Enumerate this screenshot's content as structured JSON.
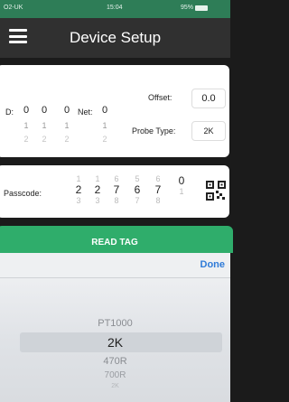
{
  "status_bar": {
    "carrier": "O2-UK",
    "time": "15:04",
    "battery": "95%"
  },
  "app_bar": {
    "title": "Device Setup",
    "menu_icon": "hamburger-icon"
  },
  "device": {
    "id_label": "D:",
    "id_wheels": [
      {
        "selected": "0",
        "below": "1",
        "far": "2"
      },
      {
        "selected": "0",
        "below": "1",
        "far": "2"
      },
      {
        "selected": "0",
        "below": "1",
        "far": "2"
      }
    ],
    "net_label": "Net:",
    "net_wheel": {
      "selected": "0",
      "below": "1",
      "far": "2"
    },
    "offset_label": "Offset:",
    "offset_value": "0.0",
    "probe_type_label": "Probe Type:",
    "probe_type_value": "2K"
  },
  "passcode": {
    "label": "Passcode:",
    "wheels": [
      {
        "above": "1",
        "selected": "2",
        "below": "3"
      },
      {
        "above": "1",
        "selected": "2",
        "below": "3"
      },
      {
        "above": "6",
        "selected": "7",
        "below": "8"
      },
      {
        "above": "5",
        "selected": "6",
        "below": "7"
      },
      {
        "above": "6",
        "selected": "7",
        "below": "8"
      },
      {
        "above": "",
        "selected": "0",
        "below": "1"
      }
    ],
    "qr_icon": "qr-code-icon"
  },
  "read_button": {
    "label": "READ TAG"
  },
  "picker": {
    "done_label": "Done",
    "options": [
      "PT1000",
      "2K",
      "470R",
      "700R",
      "2K"
    ],
    "selected": "2K"
  },
  "colors": {
    "accent": "#2fad6b",
    "status_bar": "#2e7d57",
    "app_bar": "#303030",
    "done": "#2f7bd8"
  }
}
